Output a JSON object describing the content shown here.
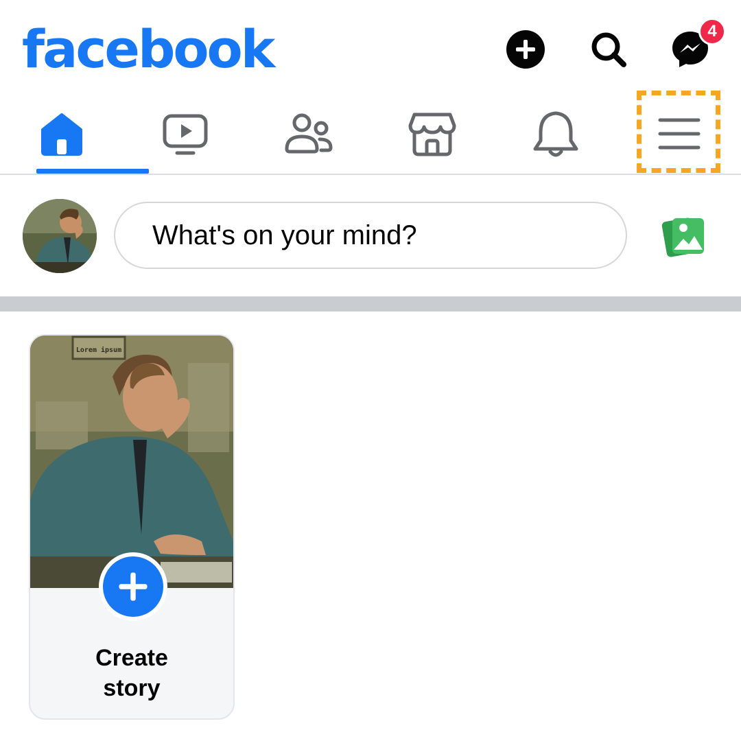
{
  "header": {
    "logo_text": "facebook",
    "brand_color": "#1877f2",
    "actions": [
      {
        "name": "create-icon"
      },
      {
        "name": "search-icon"
      },
      {
        "name": "messenger-icon",
        "badge": "4"
      }
    ]
  },
  "tabs": [
    {
      "name": "tab-home",
      "icon": "home-icon",
      "active": true
    },
    {
      "name": "tab-video",
      "icon": "video-icon",
      "active": false
    },
    {
      "name": "tab-friends",
      "icon": "friends-icon",
      "active": false
    },
    {
      "name": "tab-marketplace",
      "icon": "marketplace-icon",
      "active": false
    },
    {
      "name": "tab-notifications",
      "icon": "bell-icon",
      "active": false
    },
    {
      "name": "tab-menu",
      "icon": "menu-icon",
      "active": false,
      "highlighted": true
    }
  ],
  "composer": {
    "placeholder": "What's on your mind?",
    "photo_icon": "photo-icon",
    "photo_color": "#45bd62"
  },
  "stories": [
    {
      "label": "Create\nstory",
      "icon": "plus-icon"
    }
  ],
  "colors": {
    "accent": "#1877f2",
    "highlight": "#f5a623",
    "badge": "#f02849",
    "icon_gray": "#65676b"
  }
}
